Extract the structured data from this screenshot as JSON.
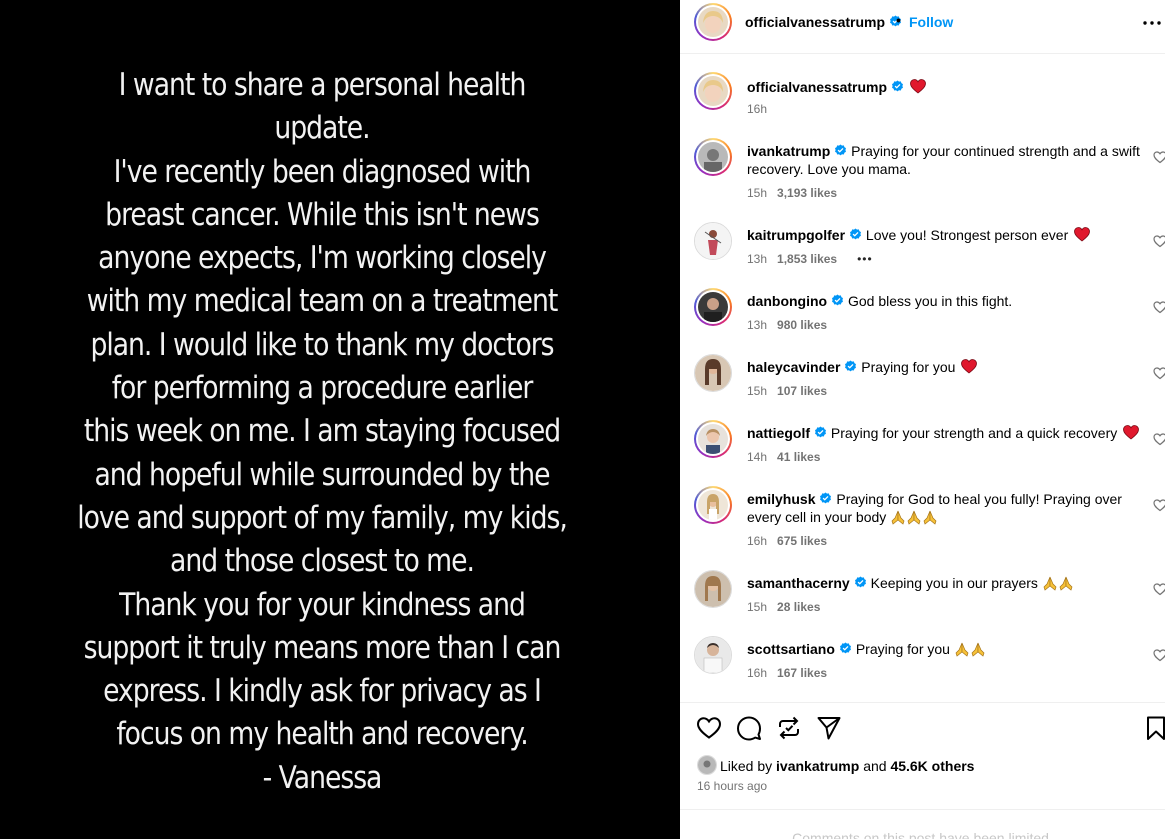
{
  "story": {
    "lines": [
      "I want to share a personal health",
      "update.",
      "I've recently been diagnosed with",
      "breast cancer. While this isn't news",
      "anyone expects, I'm working closely",
      "with my medical team on a treatment",
      "plan. I would like to thank my doctors",
      "for performing a procedure earlier",
      "this week on me. I am staying focused",
      "and hopeful while surrounded by the",
      "love and support of my family, my kids,",
      "and those closest to me.",
      "Thank you for your kindness and",
      "support it truly means more than I can",
      "express. I kindly ask for privacy as I",
      "focus on my health and recovery.",
      "- Vanessa"
    ]
  },
  "header": {
    "username": "officialvanessatrump",
    "dot": "•",
    "follow_label": "Follow",
    "more_icon": "more-horizontal-icon"
  },
  "caption": {
    "username": "officialvanessatrump",
    "text": "",
    "time": "16h"
  },
  "comments": [
    {
      "username": "ivankatrump",
      "text": "Praying for your continued strength and a swift recovery. Love you mama.",
      "emoji": "",
      "time": "15h",
      "likes": "3,193 likes",
      "ring": true
    },
    {
      "username": "kaitrumpgolfer",
      "text": "Love you! Strongest person ever",
      "emoji": "heart",
      "time": "13h",
      "likes": "1,853 likes",
      "extra": "•••",
      "ring": false
    },
    {
      "username": "danbongino",
      "text": "God bless you in this fight.",
      "emoji": "",
      "time": "13h",
      "likes": "980 likes",
      "ring": true
    },
    {
      "username": "haleycavinder",
      "text": "Praying for you",
      "emoji": "heart",
      "time": "15h",
      "likes": "107 likes",
      "ring": false
    },
    {
      "username": "nattiegolf",
      "text": "Praying for your strength and a quick recovery",
      "emoji": "heart",
      "time": "14h",
      "likes": "41 likes",
      "ring": true
    },
    {
      "username": "emilyhusk",
      "text": "Praying for God to heal you fully! Praying over every cell in your body",
      "emoji": "pray3",
      "time": "16h",
      "likes": "675 likes",
      "ring": true
    },
    {
      "username": "samanthacerny",
      "text": "Keeping you in our prayers",
      "emoji": "pray2",
      "time": "15h",
      "likes": "28 likes",
      "ring": false
    },
    {
      "username": "scottsartiano",
      "text": "Praying for you",
      "emoji": "pray2",
      "time": "16h",
      "likes": "167 likes",
      "ring": false
    }
  ],
  "actions": {
    "liked_by_prefix": "Liked by",
    "liked_by_user": "ivankatrump",
    "liked_by_and": "and",
    "liked_by_others": "45.6K others",
    "timestamp": "16 hours ago",
    "limited_text": "Comments on this post have been limited."
  },
  "colors": {
    "accent": "#0095f6",
    "verified": "#0095f6",
    "heart": "#e0182d",
    "muted": "#737373"
  }
}
